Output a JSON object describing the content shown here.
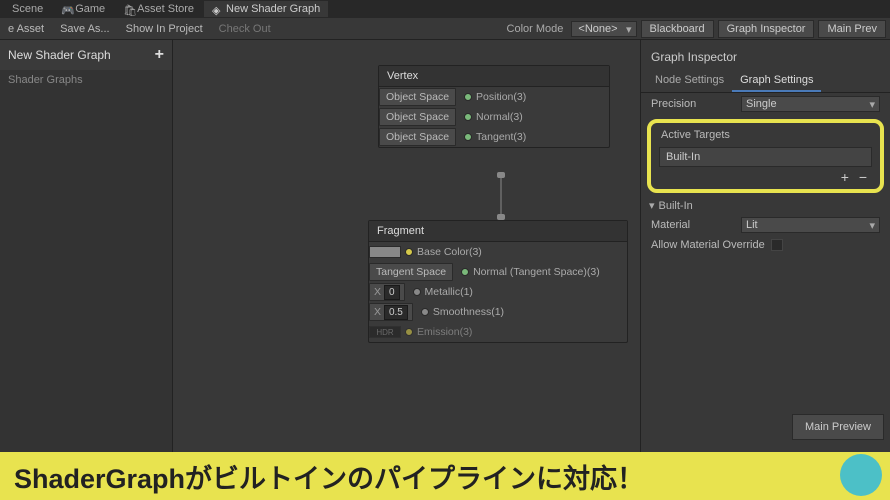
{
  "top_tabs": {
    "scene": "Scene",
    "game": "Game",
    "store": "Asset Store",
    "graph": "New Shader Graph"
  },
  "toolbar": {
    "asset": "e Asset",
    "save_as": "Save As...",
    "show": "Show In Project",
    "checkout": "Check Out",
    "color_mode_lbl": "Color Mode",
    "color_mode_val": "<None>",
    "blackboard": "Blackboard",
    "graph_insp": "Graph Inspector",
    "main_prev": "Main Prev"
  },
  "sidebar": {
    "title": "New Shader Graph",
    "sub": "Shader Graphs",
    "add": "+"
  },
  "vertex": {
    "title": "Vertex",
    "rows": [
      {
        "pill": "Object Space",
        "label": "Position(3)"
      },
      {
        "pill": "Object Space",
        "label": "Normal(3)"
      },
      {
        "pill": "Object Space",
        "label": "Tangent(3)"
      }
    ]
  },
  "fragment": {
    "title": "Fragment",
    "base_color": "Base Color(3)",
    "tangent_pill": "Tangent Space",
    "normal": "Normal (Tangent Space)(3)",
    "metallic_x": "X",
    "metallic_v": "0",
    "metallic": "Metallic(1)",
    "smooth_x": "X",
    "smooth_v": "0.5",
    "smooth": "Smoothness(1)",
    "hdr": "HDR",
    "emission": "Emission(3)"
  },
  "inspector": {
    "title": "Graph Inspector",
    "tab_node": "Node Settings",
    "tab_graph": "Graph Settings",
    "precision_lbl": "Precision",
    "precision_val": "Single",
    "active_targets": "Active Targets",
    "target_item": "Built-In",
    "plus": "+",
    "minus": "−",
    "foldout": "Built-In",
    "material_lbl": "Material",
    "material_val": "Lit",
    "allow_lbl": "Allow Material Override"
  },
  "preview_btn": "Main Preview",
  "banner": "ShaderGraphがビルトインのパイプラインに対応！"
}
